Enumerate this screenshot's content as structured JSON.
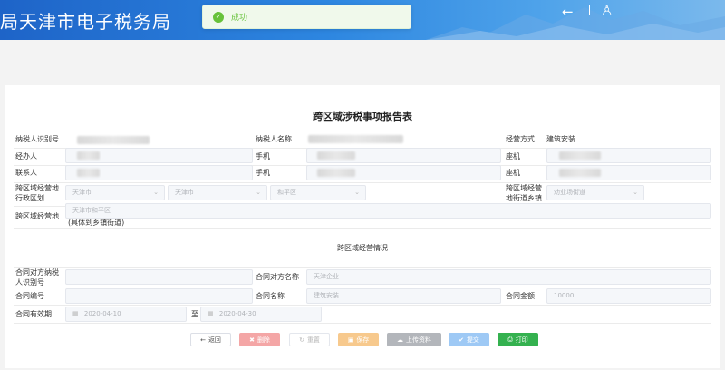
{
  "header": {
    "title": "局天津市电子税务局",
    "back_icon": "←",
    "user_icon": "♙"
  },
  "toast": {
    "message": "成功"
  },
  "form": {
    "title": "跨区域涉税事项报告表",
    "labels": {
      "taxpayer_id": "纳税人识别号",
      "taxpayer_name": "纳税人名称",
      "business_mode": "经营方式",
      "handler": "经办人",
      "mobile1": "手机",
      "landline1": "座机",
      "contact": "联系人",
      "mobile2": "手机",
      "landline2": "座机",
      "area_1": "跨区域经营地",
      "area_2": "行政区划",
      "street_1": "跨区域经营",
      "street_2": "地街道乡镇",
      "addr_1": "跨区域经营地",
      "addr_2": "(具体到乡镇街道)",
      "contract_party_id_1": "合同对方纳税",
      "contract_party_id_2": "人识别号",
      "contract_party_name": "合同对方名称",
      "contract_no": "合同编号",
      "contract_name": "合同名称",
      "contract_amount": "合同金额",
      "contract_period": "合同有效期",
      "to": "至"
    },
    "values": {
      "business_mode": "建筑安装",
      "province": "天津市",
      "city": "天津市",
      "district": "和平区",
      "street_placeholder": "劝业场街道",
      "address": "天津市和平区",
      "contract_party_name": "天津企业",
      "contract_name": "建筑安装",
      "contract_amount": "10000",
      "start_date": "2020-04-10",
      "end_date": "2020-04-30"
    },
    "section_title": "跨区域经营情况"
  },
  "buttons": {
    "back": "返回",
    "delete": "删除",
    "reset": "重置",
    "save": "保存",
    "upload": "上传资料",
    "submit": "提交",
    "print": "打印"
  },
  "colors": {
    "header": "#2d86e0",
    "success": "#67c23a",
    "danger": "#f4a6a6",
    "warning": "#f7c98d",
    "info": "#b3b6bb",
    "primary": "#9ec9f5",
    "print": "#34b14f"
  }
}
